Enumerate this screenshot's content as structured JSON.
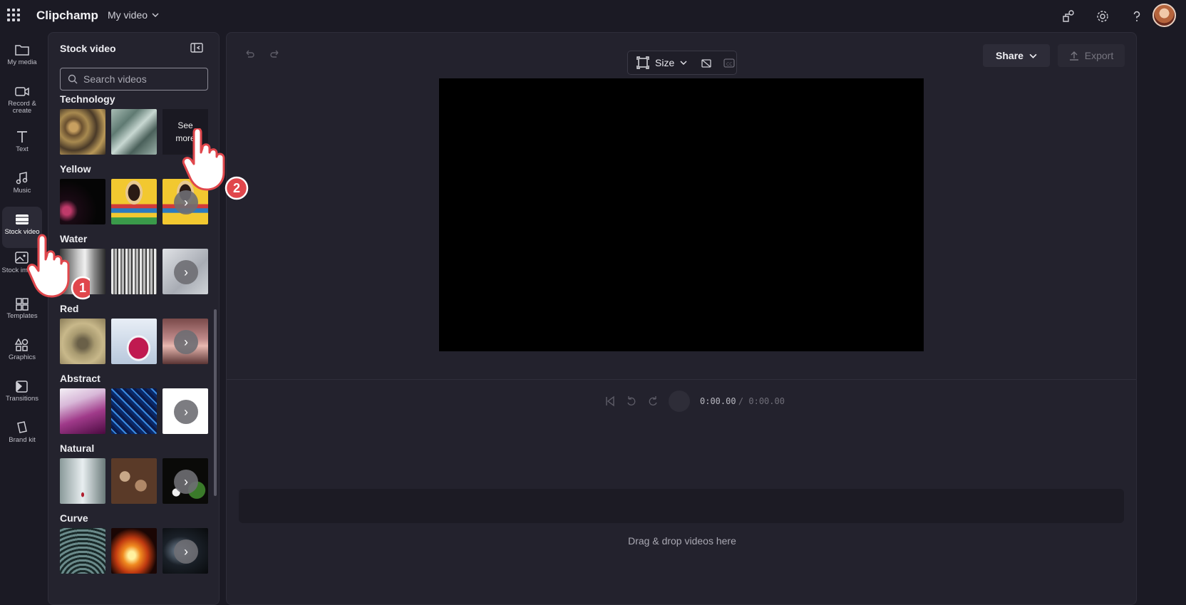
{
  "app": {
    "brand": "Clipchamp",
    "project_name": "My video"
  },
  "rail": {
    "items": [
      {
        "label": "My media",
        "icon": "folder-icon"
      },
      {
        "label": "Record & create",
        "icon": "camera-icon"
      },
      {
        "label": "Text",
        "icon": "text-icon"
      },
      {
        "label": "Music",
        "icon": "music-icon"
      },
      {
        "label": "Stock video",
        "icon": "film-icon",
        "active": true
      },
      {
        "label": "Stock images",
        "icon": "image-icon"
      },
      {
        "label": "Templates",
        "icon": "templates-icon"
      },
      {
        "label": "Graphics",
        "icon": "shapes-icon"
      },
      {
        "label": "Transitions",
        "icon": "transitions-icon"
      },
      {
        "label": "Brand kit",
        "icon": "brand-kit-icon"
      }
    ]
  },
  "panel": {
    "title": "Stock video",
    "search_placeholder": "Search videos",
    "see_more": "See more",
    "categories": [
      {
        "title": "Technology"
      },
      {
        "title": "Yellow"
      },
      {
        "title": "Water"
      },
      {
        "title": "Red"
      },
      {
        "title": "Abstract"
      },
      {
        "title": "Natural"
      },
      {
        "title": "Curve"
      }
    ]
  },
  "toolbar": {
    "size_label": "Size",
    "share_label": "Share",
    "export_label": "Export"
  },
  "playback": {
    "current": "0:00.00",
    "total": "/ 0:00.00"
  },
  "timeline": {
    "drop_hint": "Drag & drop videos here"
  },
  "annotations": {
    "step1": "1",
    "step2": "2"
  },
  "colors": {
    "background": "#1b1a24",
    "panel": "#24232e",
    "accent_red": "#e0474c"
  }
}
